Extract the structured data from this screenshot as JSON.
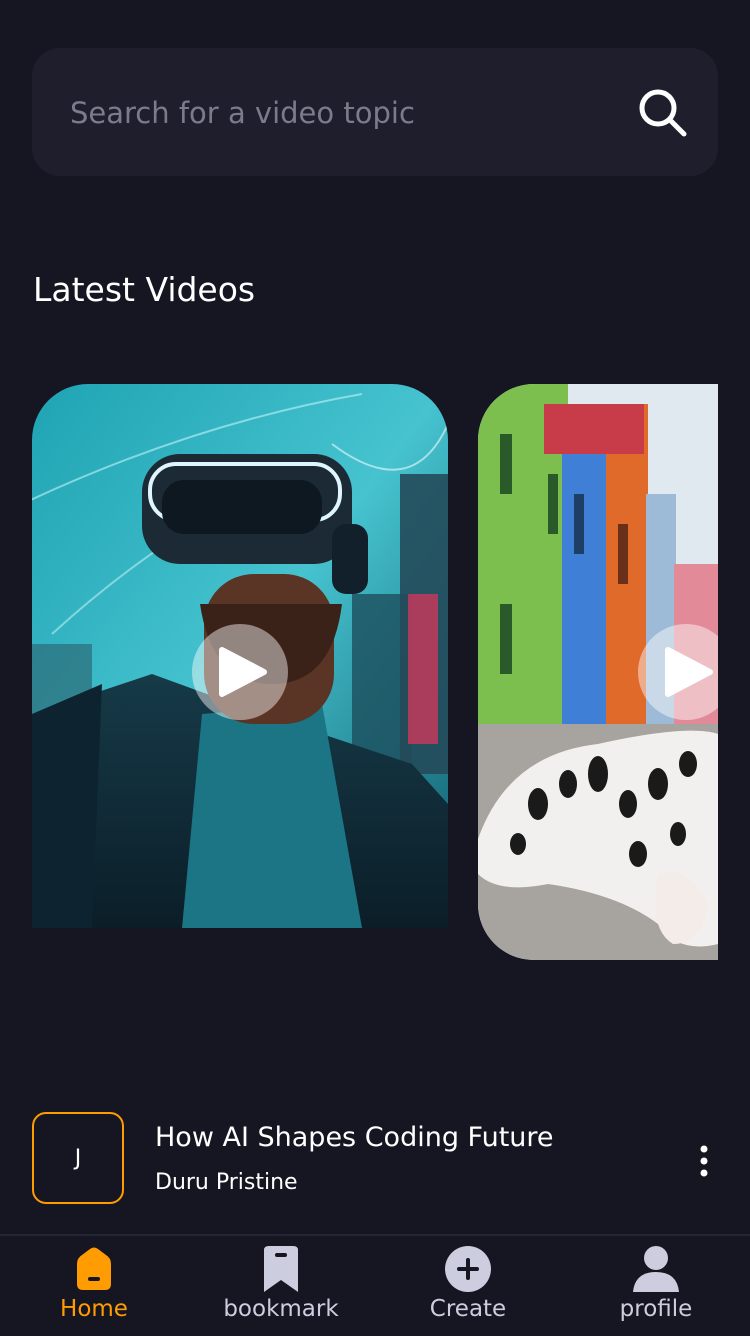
{
  "search": {
    "placeholder": "Search for a video topic",
    "icon": "search-icon"
  },
  "section": {
    "title": "Latest Videos"
  },
  "cards": [
    {
      "subject": "person in VR headset, teal neon city",
      "icon": "play-icon"
    },
    {
      "subject": "dalmatian dog lying in colorful street",
      "icon": "play-icon"
    }
  ],
  "video": {
    "avatar_initial": "J",
    "title": "How AI Shapes Coding Future",
    "author": "Duru Pristine",
    "menu_icon": "more-vertical-icon"
  },
  "tabs": [
    {
      "label": "Home",
      "icon": "home-icon",
      "active": true
    },
    {
      "label": "bookmark",
      "icon": "bookmark-icon",
      "active": false
    },
    {
      "label": "Create",
      "icon": "plus-circle-icon",
      "active": false
    },
    {
      "label": "profile",
      "icon": "profile-icon",
      "active": false
    }
  ],
  "colors": {
    "background": "#161622",
    "surface": "#1e1e2d",
    "accent": "#ff9c01",
    "inactive": "#cdcde0"
  }
}
